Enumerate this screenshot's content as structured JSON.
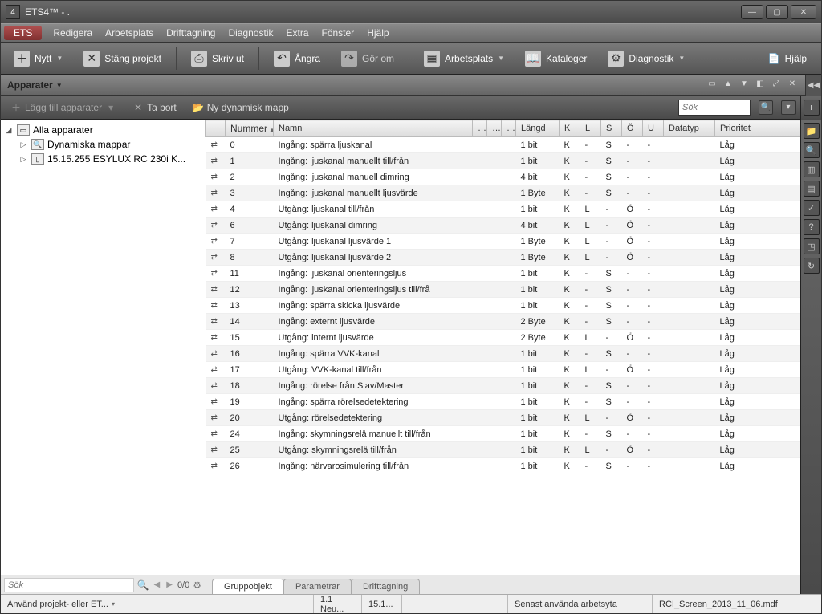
{
  "window": {
    "title": "ETS4™ - ."
  },
  "menu": {
    "ets": "ETS",
    "items": [
      "Redigera",
      "Arbetsplats",
      "Drifttagning",
      "Diagnostik",
      "Extra",
      "Fönster",
      "Hjälp"
    ]
  },
  "toolbar": {
    "nytt": "Nytt",
    "stang": "Stäng projekt",
    "skriv": "Skriv ut",
    "angra": "Ångra",
    "gorom": "Gör om",
    "arbetsplats": "Arbetsplats",
    "kataloger": "Kataloger",
    "diagnostik": "Diagnostik",
    "hjalp": "Hjälp"
  },
  "panel": {
    "name": "Apparater"
  },
  "subbar": {
    "lagg": "Lägg till apparater",
    "tabort": "Ta bort",
    "nymapp": "Ny dynamisk mapp",
    "search_placeholder": "Sök"
  },
  "tree": {
    "root": "Alla apparater",
    "dyn": "Dynamiska mappar",
    "dev": "15.15.255  ESYLUX RC 230i K...",
    "foot_search": "Sök",
    "foot_count": "0/0"
  },
  "columns": {
    "nummer": "Nummer",
    "namn": "Namn",
    "langd": "Längd",
    "k": "K",
    "l": "L",
    "s": "S",
    "o": "Ö",
    "u": "U",
    "datatyp": "Datatyp",
    "prioritet": "Prioritet"
  },
  "rows": [
    {
      "num": "0",
      "name": "Ingång: spärra ljuskanal",
      "len": "1 bit",
      "k": "K",
      "l": "-",
      "s": "S",
      "o": "-",
      "u": "-",
      "dt": "",
      "prio": "Låg"
    },
    {
      "num": "1",
      "name": "Ingång: ljuskanal manuellt till/från",
      "len": "1 bit",
      "k": "K",
      "l": "-",
      "s": "S",
      "o": "-",
      "u": "-",
      "dt": "",
      "prio": "Låg"
    },
    {
      "num": "2",
      "name": "Ingång: ljuskanal manuell dimring",
      "len": "4 bit",
      "k": "K",
      "l": "-",
      "s": "S",
      "o": "-",
      "u": "-",
      "dt": "",
      "prio": "Låg"
    },
    {
      "num": "3",
      "name": "Ingång: ljuskanal manuellt ljusvärde",
      "len": "1 Byte",
      "k": "K",
      "l": "-",
      "s": "S",
      "o": "-",
      "u": "-",
      "dt": "",
      "prio": "Låg"
    },
    {
      "num": "4",
      "name": "Utgång: ljuskanal till/från",
      "len": "1 bit",
      "k": "K",
      "l": "L",
      "s": "-",
      "o": "Ö",
      "u": "-",
      "dt": "",
      "prio": "Låg"
    },
    {
      "num": "6",
      "name": "Utgång: ljuskanal dimring",
      "len": "4 bit",
      "k": "K",
      "l": "L",
      "s": "-",
      "o": "Ö",
      "u": "-",
      "dt": "",
      "prio": "Låg"
    },
    {
      "num": "7",
      "name": "Utgång: ljuskanal ljusvärde 1",
      "len": "1 Byte",
      "k": "K",
      "l": "L",
      "s": "-",
      "o": "Ö",
      "u": "-",
      "dt": "",
      "prio": "Låg"
    },
    {
      "num": "8",
      "name": "Utgång: ljuskanal ljusvärde 2",
      "len": "1 Byte",
      "k": "K",
      "l": "L",
      "s": "-",
      "o": "Ö",
      "u": "-",
      "dt": "",
      "prio": "Låg"
    },
    {
      "num": "11",
      "name": "Ingång: ljuskanal orienteringsljus",
      "len": "1 bit",
      "k": "K",
      "l": "-",
      "s": "S",
      "o": "-",
      "u": "-",
      "dt": "",
      "prio": "Låg"
    },
    {
      "num": "12",
      "name": "Ingång: ljuskanal orienteringsljus till/frå",
      "len": "1 bit",
      "k": "K",
      "l": "-",
      "s": "S",
      "o": "-",
      "u": "-",
      "dt": "",
      "prio": "Låg"
    },
    {
      "num": "13",
      "name": "Ingång: spärra skicka ljusvärde",
      "len": "1 bit",
      "k": "K",
      "l": "-",
      "s": "S",
      "o": "-",
      "u": "-",
      "dt": "",
      "prio": "Låg"
    },
    {
      "num": "14",
      "name": "Ingång: externt ljusvärde",
      "len": "2 Byte",
      "k": "K",
      "l": "-",
      "s": "S",
      "o": "-",
      "u": "-",
      "dt": "",
      "prio": "Låg"
    },
    {
      "num": "15",
      "name": "Utgång: internt ljusvärde",
      "len": "2 Byte",
      "k": "K",
      "l": "L",
      "s": "-",
      "o": "Ö",
      "u": "-",
      "dt": "",
      "prio": "Låg"
    },
    {
      "num": "16",
      "name": "Ingång: spärra VVK-kanal",
      "len": "1 bit",
      "k": "K",
      "l": "-",
      "s": "S",
      "o": "-",
      "u": "-",
      "dt": "",
      "prio": "Låg"
    },
    {
      "num": "17",
      "name": "Utgång: VVK-kanal till/från",
      "len": "1 bit",
      "k": "K",
      "l": "L",
      "s": "-",
      "o": "Ö",
      "u": "-",
      "dt": "",
      "prio": "Låg"
    },
    {
      "num": "18",
      "name": "Ingång: rörelse från Slav/Master",
      "len": "1 bit",
      "k": "K",
      "l": "-",
      "s": "S",
      "o": "-",
      "u": "-",
      "dt": "",
      "prio": "Låg"
    },
    {
      "num": "19",
      "name": "Ingång: spärra rörelsedetektering",
      "len": "1 bit",
      "k": "K",
      "l": "-",
      "s": "S",
      "o": "-",
      "u": "-",
      "dt": "",
      "prio": "Låg"
    },
    {
      "num": "20",
      "name": "Utgång: rörelsedetektering",
      "len": "1 bit",
      "k": "K",
      "l": "L",
      "s": "-",
      "o": "Ö",
      "u": "-",
      "dt": "",
      "prio": "Låg"
    },
    {
      "num": "24",
      "name": "Ingång: skymningsrelä manuellt till/från",
      "len": "1 bit",
      "k": "K",
      "l": "-",
      "s": "S",
      "o": "-",
      "u": "-",
      "dt": "",
      "prio": "Låg"
    },
    {
      "num": "25",
      "name": "Utgång: skymningsrelä till/från",
      "len": "1 bit",
      "k": "K",
      "l": "L",
      "s": "-",
      "o": "Ö",
      "u": "-",
      "dt": "",
      "prio": "Låg"
    },
    {
      "num": "26",
      "name": "Ingång: närvarosimulering till/från",
      "len": "1 bit",
      "k": "K",
      "l": "-",
      "s": "S",
      "o": "-",
      "u": "-",
      "dt": "",
      "prio": "Låg"
    }
  ],
  "bottom_tabs": {
    "grupp": "Gruppobjekt",
    "param": "Parametrar",
    "drift": "Drifttagning"
  },
  "status": {
    "project": "Använd projekt- eller ET...",
    "c1": "1.1 Neu...",
    "c2": "15.1...",
    "workspace": "Senast använda arbetsyta",
    "file": "RCI_Screen_2013_11_06.mdf"
  }
}
